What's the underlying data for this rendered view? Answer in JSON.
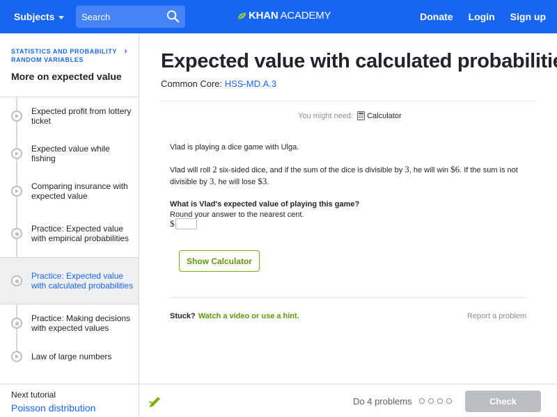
{
  "header": {
    "subjects": "Subjects",
    "search_placeholder": "Search",
    "logo_bold": "KHAN",
    "logo_light": "ACADEMY",
    "donate": "Donate",
    "login": "Login",
    "signup": "Sign up",
    "bar_color": "#1865f2"
  },
  "sidebar": {
    "breadcrumb_line1": "STATISTICS AND PROBABILITY",
    "breadcrumb_line2": "RANDOM VARIABLES",
    "title": "More on expected value",
    "items": [
      {
        "label": "Expected profit from lottery ticket",
        "icon": "video-icon"
      },
      {
        "label": "Expected value while fishing",
        "icon": "video-icon"
      },
      {
        "label": "Comparing insurance with expected value",
        "icon": "video-icon"
      },
      {
        "label": "Practice: Expected value with empirical probabilities",
        "icon": "practice-star-icon"
      },
      {
        "label": "Practice: Expected value with calculated probabilities",
        "icon": "practice-star-icon",
        "active": true
      },
      {
        "label": "Practice: Making decisions with expected values",
        "icon": "practice-star-icon"
      },
      {
        "label": "Law of large numbers",
        "icon": "video-icon"
      }
    ],
    "next_label": "Next tutorial",
    "next_value": "Poisson distribution"
  },
  "main": {
    "title": "Expected value with calculated probabilities",
    "cc_label": "Common Core: ",
    "cc_link": "HSS-MD.A.3",
    "might_need": "You might need:",
    "calculator_label": "Calculator",
    "p1": "Vlad is playing a dice game with Ulga.",
    "p2_a": "Vlad will roll ",
    "p2_n1": "2",
    "p2_b": " six-sided dice, and if the sum of the dice is divisible by ",
    "p2_n2": "3",
    "p2_c": ", he will win ",
    "p2_n3": "$6",
    "p2_d": ". If the sum is not divisible by ",
    "p2_n4": "3",
    "p2_e": ", he will lose ",
    "p2_n5": "$3",
    "p2_f": ".",
    "question": "What is Vlad's expected value of playing this game?",
    "instruction": "Round your answer to the nearest cent.",
    "answer_prefix": "$",
    "answer_value": "",
    "show_calculator": "Show Calculator",
    "stuck": "Stuck?",
    "hint_link": "Watch a video or use a hint.",
    "report": "Report a problem"
  },
  "footer": {
    "do_problems": "Do 4 problems",
    "check": "Check",
    "progress_dots": 4
  }
}
